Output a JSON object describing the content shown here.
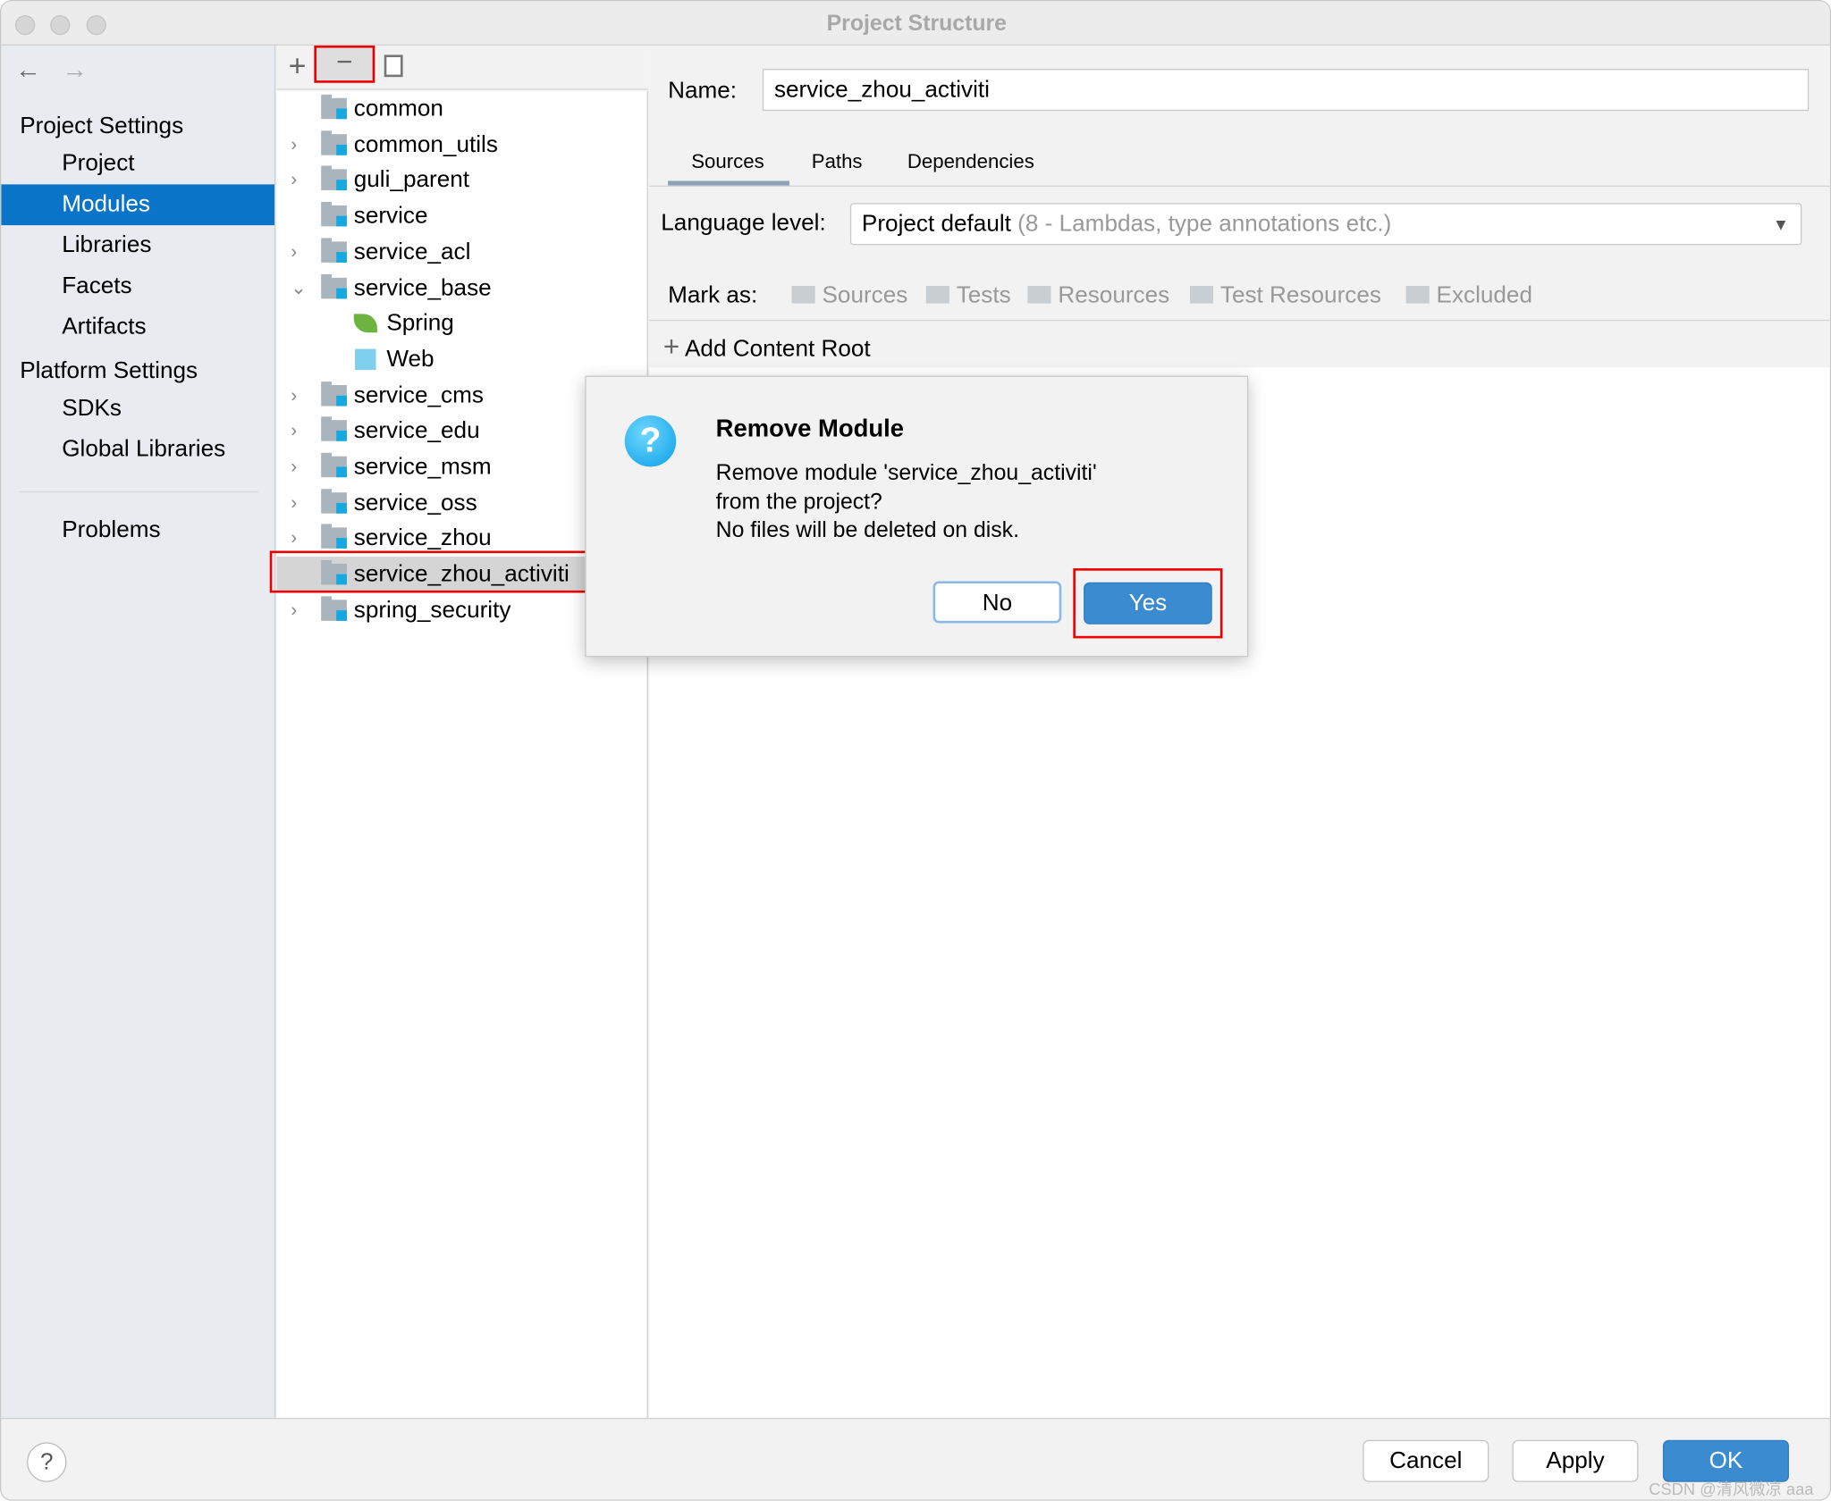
{
  "window": {
    "title": "Project Structure"
  },
  "sidebar": {
    "project_settings": "Project Settings",
    "items": [
      {
        "label": "Project"
      },
      {
        "label": "Modules",
        "selected": true
      },
      {
        "label": "Libraries"
      },
      {
        "label": "Facets"
      },
      {
        "label": "Artifacts"
      }
    ],
    "platform_settings": "Platform Settings",
    "platform_items": [
      {
        "label": "SDKs"
      },
      {
        "label": "Global Libraries"
      }
    ],
    "problems": "Problems"
  },
  "tree": {
    "items": [
      {
        "label": "common",
        "expand": ""
      },
      {
        "label": "common_utils",
        "expand": "›"
      },
      {
        "label": "guli_parent",
        "expand": "›"
      },
      {
        "label": "service",
        "expand": ""
      },
      {
        "label": "service_acl",
        "expand": "›"
      },
      {
        "label": "service_base",
        "expand": "⌄"
      },
      {
        "label": "Spring",
        "child": true,
        "icon": "spring-leaf"
      },
      {
        "label": "Web",
        "child": true,
        "icon": "web"
      },
      {
        "label": "service_cms",
        "expand": "›"
      },
      {
        "label": "service_edu",
        "expand": "›"
      },
      {
        "label": "service_msm",
        "expand": "›"
      },
      {
        "label": "service_oss",
        "expand": "›"
      },
      {
        "label": "service_zhou",
        "expand": "›"
      },
      {
        "label": "service_zhou_activiti",
        "expand": "",
        "selected": true
      },
      {
        "label": "spring_security",
        "expand": "›"
      }
    ]
  },
  "details": {
    "name_label": "Name:",
    "name_value": "service_zhou_activiti",
    "tabs": [
      {
        "label": "Sources",
        "active": true
      },
      {
        "label": "Paths"
      },
      {
        "label": "Dependencies"
      }
    ],
    "language_label": "Language level:",
    "language_value": "Project default",
    "language_hint": "(8 - Lambdas, type annotations etc.)",
    "mark_as": "Mark as:",
    "marks": [
      "Sources",
      "Tests",
      "Resources",
      "Test Resources",
      "Excluded"
    ],
    "add_root": "Add Content Root"
  },
  "dialog": {
    "title": "Remove Module",
    "line1": "Remove module 'service_zhou_activiti'",
    "line2": "from the project?",
    "line3": "No files will be deleted on disk.",
    "no": "No",
    "yes": "Yes"
  },
  "footer": {
    "help": "?",
    "cancel": "Cancel",
    "apply": "Apply",
    "ok": "OK"
  },
  "watermark": "CSDN @清风微凉 aaa",
  "colors": {
    "accent": "#0a75c8",
    "highlight": "#ee0000"
  }
}
